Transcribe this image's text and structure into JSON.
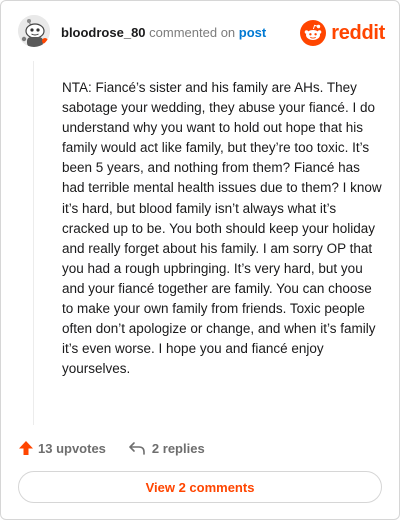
{
  "comment": {
    "author": "bloodrose_80",
    "action_text": "commented on",
    "target_link": "post",
    "body": "NTA: Fiancé’s sister and his family are AHs. They sabotage your wedding, they abuse your fiancé. I do understand why you want to hold out hope that his family would act like family, but they’re too toxic. It’s been 5 years, and nothing from them? Fiancé has had terrible mental health issues due to them? I know it’s hard, but blood family isn’t always what it’s cracked up to be. You both should keep your holiday and really forget about his family. I am sorry OP that you had a rough upbringing. It’s very hard, but you and your fiancé together are family. You can choose to make your own family from friends. Toxic people often don’t apologize or change, and when it’s family it’s even worse. I hope you and fiancé enjoy yourselves.",
    "upvotes": "13 upvotes",
    "replies": "2 replies"
  },
  "brand": {
    "name": "reddit",
    "color": "#ff4500"
  },
  "view_comments_label": "View 2 comments",
  "icons": {
    "avatar": "snoo-avatar",
    "logo": "reddit-logo-icon",
    "upvote": "upvote-arrow-icon",
    "reply": "reply-arrow-icon"
  }
}
